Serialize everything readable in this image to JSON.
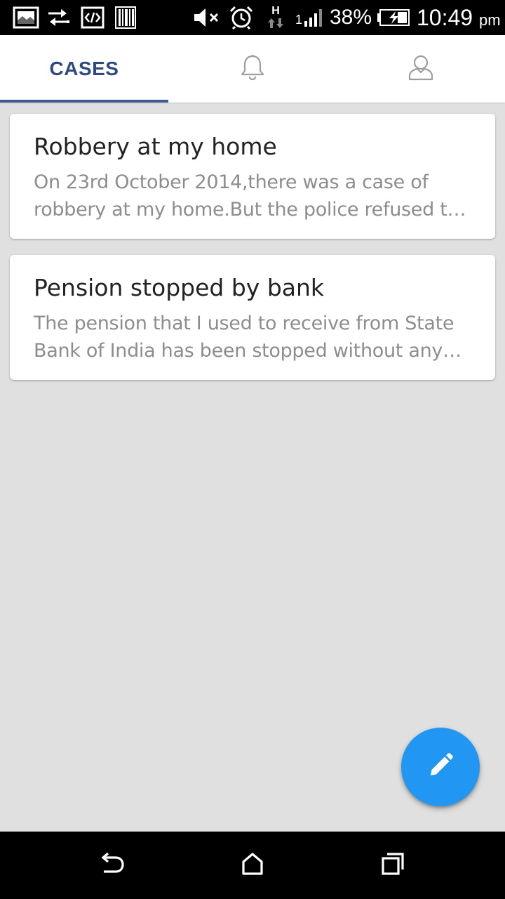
{
  "status_bar": {
    "battery_percent": "38%",
    "time": "10:49",
    "ampm": "pm",
    "network_type": "H",
    "signal_sim": "1",
    "icons": [
      "gallery-icon",
      "sync-icon",
      "code-icon",
      "barcode-icon",
      "mute-icon",
      "alarm-icon",
      "data-arrows-icon",
      "signal-icon",
      "battery-charging-icon"
    ]
  },
  "tabs": [
    {
      "label": "CASES",
      "icon": null,
      "active": true
    },
    {
      "label": "",
      "icon": "bell-icon",
      "active": false
    },
    {
      "label": "",
      "icon": "person-icon",
      "active": false
    }
  ],
  "cases": [
    {
      "title": "Robbery at my home",
      "description": "On 23rd October 2014,there was a case of robbery at my home.But the police refused to register the case."
    },
    {
      "title": "Pension stopped by bank",
      "description": "The pension that I used to receive from State Bank of India has been stopped without any reason."
    }
  ],
  "fab": {
    "icon": "pencil-icon"
  },
  "nav_bar": {
    "icons": [
      "back-icon",
      "home-icon",
      "recents-icon"
    ]
  },
  "colors": {
    "accent": "#2e4a82",
    "tab_indicator": "#3d5a96",
    "fab": "#2196f3",
    "background": "#e0e0e0",
    "title_text": "#222222",
    "description_text": "#8d8d8d"
  }
}
